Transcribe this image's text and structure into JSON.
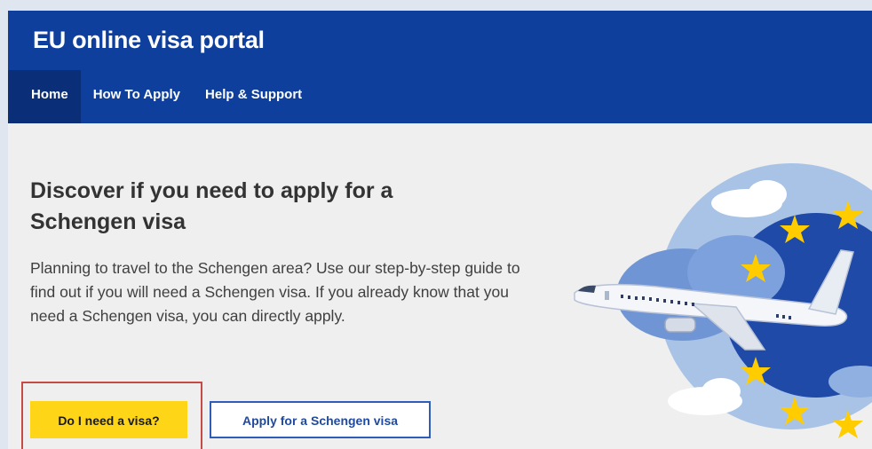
{
  "header": {
    "portal_title": "EU online visa portal"
  },
  "nav": {
    "items": [
      {
        "label": "Home",
        "active": true
      },
      {
        "label": "How To Apply",
        "active": false
      },
      {
        "label": "Help & Support",
        "active": false
      }
    ]
  },
  "main": {
    "headline_line1": "Discover if you need to apply for a",
    "headline_line2": "Schengen visa",
    "intro": "Planning to travel to the Schengen area? Use our step-by-step guide to find out if you will need a Schengen visa. If you already know that you need a Schengen visa, you can directly apply.",
    "primary_button": "Do I need a visa?",
    "secondary_button": "Apply for a Schengen visa"
  },
  "colors": {
    "header_bg": "#0e3f9c",
    "nav_active_bg": "#0a2f78",
    "primary_button_bg": "#ffd617",
    "secondary_button_border": "#2e5cb8",
    "highlight_border": "#c64a45",
    "eu_star": "#ffcc00"
  },
  "icons": {
    "illustration": "airplane-eu-stars-illustration"
  }
}
